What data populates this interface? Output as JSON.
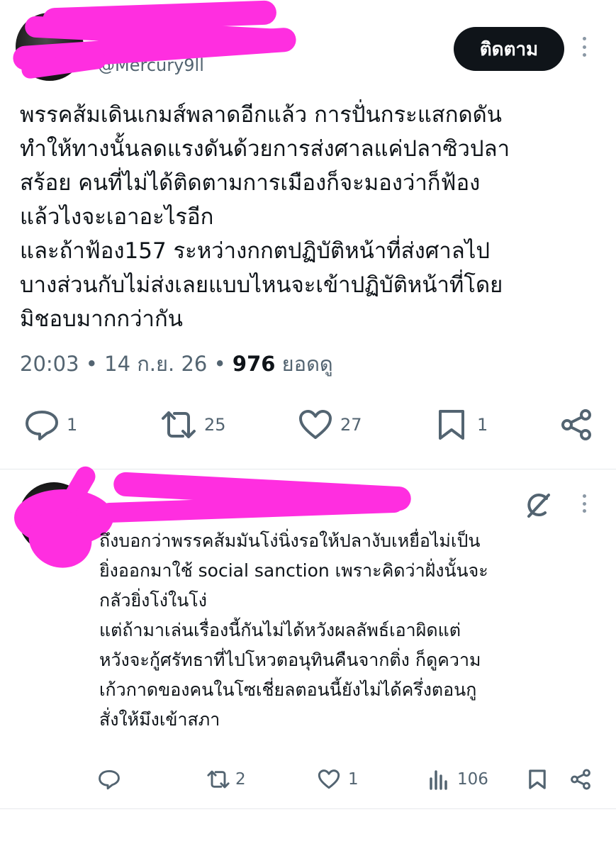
{
  "main_post": {
    "handle": "@Mercury9ll",
    "follow_label": "ติดตาม",
    "lines": [
      "พรรคส้มเดินเกมส์พลาดอีกแล้ว การปั่นกระแสกดดัน",
      "ทำให้ทางนั้นลดแรงดันด้วยการส่งศาลแค่ปลาซิวปลา",
      "สร้อย คนที่ไม่ได้ติดตามการเมืองก็จะมองว่าก็ฟ้อง",
      "แล้วไงจะเอาอะไรอีก",
      "และถ้าฟ้อง157 ระหว่างกกตปฏิบัติหน้าที่ส่งศาลไป",
      "บางส่วนกับไม่ส่งเลยแบบไหนจะเข้าปฏิบัติหน้าที่โดย",
      "มิชอบมากกว่ากัน"
    ],
    "time": "20:03",
    "dot": "•",
    "date": "14 ก.ย. 26",
    "views_count": "976",
    "views_label": "ยอดดู",
    "stats": {
      "replies": "1",
      "reposts": "25",
      "likes": "27",
      "bookmarks": "1"
    }
  },
  "reply_post": {
    "lines": [
      "ถึงบอกว่าพรรคส้มมันโง่นิ่งรอให้ปลางับเหยื่อไม่เป็น",
      "ยิ่งออกมาใช้ social sanction เพราะคิดว่าฝั่งนั้นจะ",
      "กลัวยิ่งโง่ในโง่",
      "แต่ถ้ามาเล่นเรื่องนี้กันไม่ได้หวังผลลัพธ์เอาผิดแต่",
      "หวังจะกู้ศรัทธาที่ไปโหวตอนุทินคืนจากติ่ง ก็ดูความ",
      "เก้วกาดของคนในโซเชี่ยลตอนนี้ยังไม่ได้ครึ่งตอนกู",
      "สั่งให้มึงเข้าสภา"
    ],
    "stats": {
      "replies": "",
      "reposts": "2",
      "likes": "1",
      "views": "106"
    }
  },
  "colors": {
    "text": "#0f1419",
    "secondary": "#536471",
    "redaction": "#ff2ee0",
    "follow_bg": "#0f1419"
  },
  "icons": {
    "reply": "comment-icon",
    "repost": "repost-icon",
    "like": "heart-icon",
    "bookmark": "bookmark-icon",
    "share": "share-icon",
    "views": "views-icon",
    "grok": "grok-icon",
    "more": "more-icon"
  }
}
